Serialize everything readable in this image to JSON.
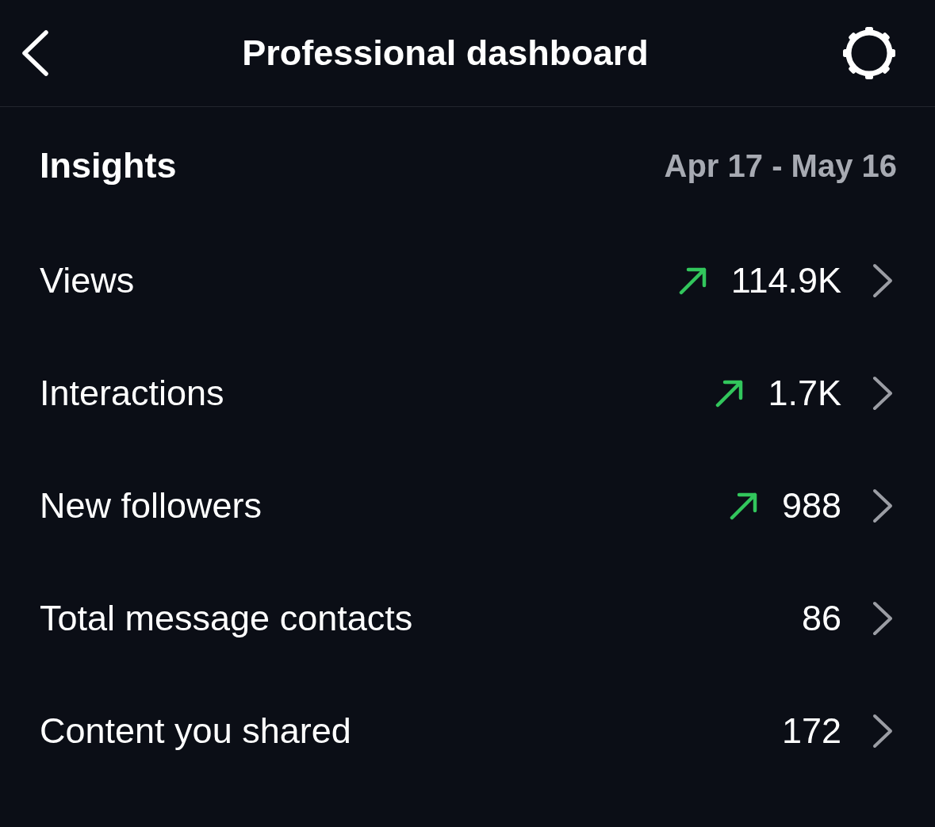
{
  "header": {
    "title": "Professional dashboard"
  },
  "insights": {
    "title": "Insights",
    "date_range": "Apr 17 - May 16"
  },
  "metrics": [
    {
      "label": "Views",
      "value": "114.9K",
      "trending_up": true
    },
    {
      "label": "Interactions",
      "value": "1.7K",
      "trending_up": true
    },
    {
      "label": "New followers",
      "value": "988",
      "trending_up": true
    },
    {
      "label": "Total message contacts",
      "value": "86",
      "trending_up": false
    },
    {
      "label": "Content you shared",
      "value": "172",
      "trending_up": false
    }
  ]
}
